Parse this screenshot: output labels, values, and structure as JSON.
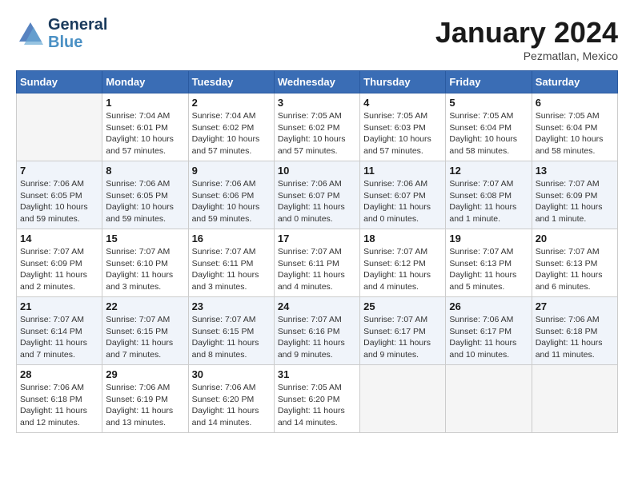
{
  "header": {
    "logo_line1": "General",
    "logo_line2": "Blue",
    "month": "January 2024",
    "location": "Pezmatlan, Mexico"
  },
  "weekdays": [
    "Sunday",
    "Monday",
    "Tuesday",
    "Wednesday",
    "Thursday",
    "Friday",
    "Saturday"
  ],
  "weeks": [
    [
      {
        "day": "",
        "info": ""
      },
      {
        "day": "1",
        "info": "Sunrise: 7:04 AM\nSunset: 6:01 PM\nDaylight: 10 hours\nand 57 minutes."
      },
      {
        "day": "2",
        "info": "Sunrise: 7:04 AM\nSunset: 6:02 PM\nDaylight: 10 hours\nand 57 minutes."
      },
      {
        "day": "3",
        "info": "Sunrise: 7:05 AM\nSunset: 6:02 PM\nDaylight: 10 hours\nand 57 minutes."
      },
      {
        "day": "4",
        "info": "Sunrise: 7:05 AM\nSunset: 6:03 PM\nDaylight: 10 hours\nand 57 minutes."
      },
      {
        "day": "5",
        "info": "Sunrise: 7:05 AM\nSunset: 6:04 PM\nDaylight: 10 hours\nand 58 minutes."
      },
      {
        "day": "6",
        "info": "Sunrise: 7:05 AM\nSunset: 6:04 PM\nDaylight: 10 hours\nand 58 minutes."
      }
    ],
    [
      {
        "day": "7",
        "info": "Sunrise: 7:06 AM\nSunset: 6:05 PM\nDaylight: 10 hours\nand 59 minutes."
      },
      {
        "day": "8",
        "info": "Sunrise: 7:06 AM\nSunset: 6:05 PM\nDaylight: 10 hours\nand 59 minutes."
      },
      {
        "day": "9",
        "info": "Sunrise: 7:06 AM\nSunset: 6:06 PM\nDaylight: 10 hours\nand 59 minutes."
      },
      {
        "day": "10",
        "info": "Sunrise: 7:06 AM\nSunset: 6:07 PM\nDaylight: 11 hours\nand 0 minutes."
      },
      {
        "day": "11",
        "info": "Sunrise: 7:06 AM\nSunset: 6:07 PM\nDaylight: 11 hours\nand 0 minutes."
      },
      {
        "day": "12",
        "info": "Sunrise: 7:07 AM\nSunset: 6:08 PM\nDaylight: 11 hours\nand 1 minute."
      },
      {
        "day": "13",
        "info": "Sunrise: 7:07 AM\nSunset: 6:09 PM\nDaylight: 11 hours\nand 1 minute."
      }
    ],
    [
      {
        "day": "14",
        "info": "Sunrise: 7:07 AM\nSunset: 6:09 PM\nDaylight: 11 hours\nand 2 minutes."
      },
      {
        "day": "15",
        "info": "Sunrise: 7:07 AM\nSunset: 6:10 PM\nDaylight: 11 hours\nand 3 minutes."
      },
      {
        "day": "16",
        "info": "Sunrise: 7:07 AM\nSunset: 6:11 PM\nDaylight: 11 hours\nand 3 minutes."
      },
      {
        "day": "17",
        "info": "Sunrise: 7:07 AM\nSunset: 6:11 PM\nDaylight: 11 hours\nand 4 minutes."
      },
      {
        "day": "18",
        "info": "Sunrise: 7:07 AM\nSunset: 6:12 PM\nDaylight: 11 hours\nand 4 minutes."
      },
      {
        "day": "19",
        "info": "Sunrise: 7:07 AM\nSunset: 6:13 PM\nDaylight: 11 hours\nand 5 minutes."
      },
      {
        "day": "20",
        "info": "Sunrise: 7:07 AM\nSunset: 6:13 PM\nDaylight: 11 hours\nand 6 minutes."
      }
    ],
    [
      {
        "day": "21",
        "info": "Sunrise: 7:07 AM\nSunset: 6:14 PM\nDaylight: 11 hours\nand 7 minutes."
      },
      {
        "day": "22",
        "info": "Sunrise: 7:07 AM\nSunset: 6:15 PM\nDaylight: 11 hours\nand 7 minutes."
      },
      {
        "day": "23",
        "info": "Sunrise: 7:07 AM\nSunset: 6:15 PM\nDaylight: 11 hours\nand 8 minutes."
      },
      {
        "day": "24",
        "info": "Sunrise: 7:07 AM\nSunset: 6:16 PM\nDaylight: 11 hours\nand 9 minutes."
      },
      {
        "day": "25",
        "info": "Sunrise: 7:07 AM\nSunset: 6:17 PM\nDaylight: 11 hours\nand 9 minutes."
      },
      {
        "day": "26",
        "info": "Sunrise: 7:06 AM\nSunset: 6:17 PM\nDaylight: 11 hours\nand 10 minutes."
      },
      {
        "day": "27",
        "info": "Sunrise: 7:06 AM\nSunset: 6:18 PM\nDaylight: 11 hours\nand 11 minutes."
      }
    ],
    [
      {
        "day": "28",
        "info": "Sunrise: 7:06 AM\nSunset: 6:18 PM\nDaylight: 11 hours\nand 12 minutes."
      },
      {
        "day": "29",
        "info": "Sunrise: 7:06 AM\nSunset: 6:19 PM\nDaylight: 11 hours\nand 13 minutes."
      },
      {
        "day": "30",
        "info": "Sunrise: 7:06 AM\nSunset: 6:20 PM\nDaylight: 11 hours\nand 14 minutes."
      },
      {
        "day": "31",
        "info": "Sunrise: 7:05 AM\nSunset: 6:20 PM\nDaylight: 11 hours\nand 14 minutes."
      },
      {
        "day": "",
        "info": ""
      },
      {
        "day": "",
        "info": ""
      },
      {
        "day": "",
        "info": ""
      }
    ]
  ]
}
